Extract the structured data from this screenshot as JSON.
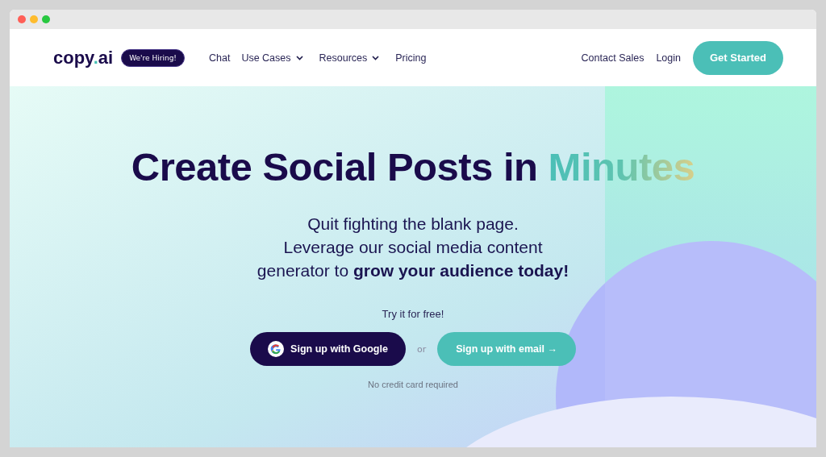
{
  "logo": {
    "before": "copy",
    "dot": ".",
    "after": "ai"
  },
  "hiring_badge": "We're Hiring!",
  "nav": [
    {
      "label": "Chat",
      "dropdown": false
    },
    {
      "label": "Use Cases",
      "dropdown": true
    },
    {
      "label": "Resources",
      "dropdown": true
    },
    {
      "label": "Pricing",
      "dropdown": false
    }
  ],
  "nav_right": {
    "contact": "Contact Sales",
    "login": "Login",
    "cta": "Get Started"
  },
  "headline": {
    "text": "Create Social Posts in",
    "highlight": "Minutes"
  },
  "subtitle": [
    "Quit fighting the blank page.",
    "Leverage our social media content",
    "generator to **grow your audience today!**"
  ],
  "try_label": "Try it for free!",
  "google_button": "Sign up with Google",
  "or_label": "or",
  "email_button": {
    "label": "Sign up with email",
    "arrow": "→"
  },
  "note": "No credit card required"
}
